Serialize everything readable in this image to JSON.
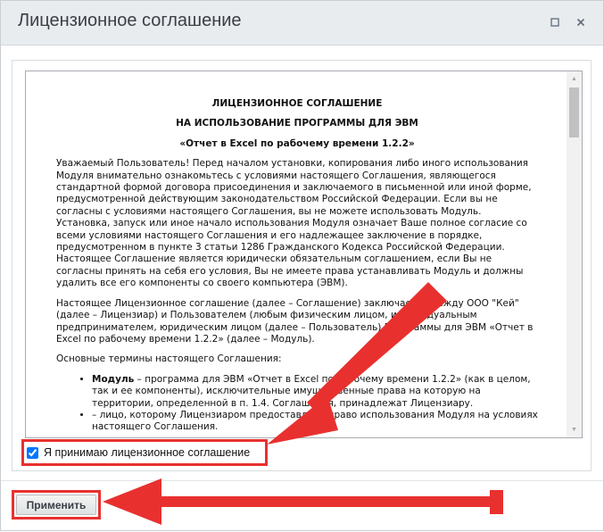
{
  "window": {
    "title": "Лицензионное соглашение",
    "maximize_icon": "maximize-icon",
    "close_icon": "close-icon"
  },
  "document": {
    "heading1": "ЛИЦЕНЗИОННОЕ СОГЛАШЕНИЕ",
    "heading2": "НА ИСПОЛЬЗОВАНИЕ ПРОГРАММЫ ДЛЯ ЭВМ",
    "heading3": "«Отчет в Excel по рабочему времени 1.2.2»",
    "paragraph1": "Уважаемый Пользователь! Перед началом установки, копирования либо иного использования Модуля внимательно ознакомьтесь с условиями настоящего Соглашения, являющегося стандартной формой договора присоединения и заключаемого в письменной или иной форме, предусмотренной действующим законодательством Российской Федерации. Если вы не согласны с условиями настоящего Соглашения, вы не можете использовать Модуль. Установка, запуск или иное начало использования Модуля означает Ваше полное согласие со всеми условиями настоящего Соглашения и его надлежащее заключение в порядке, предусмотренном в пункте 3 статьи 1286 Гражданского Кодекса Российской Федерации. Настоящее Соглашение является юридически обязательным соглашением, если Вы не согласны принять на себя его условия, Вы не имеете права устанавливать Модуль и должны удалить все его компоненты со своего компьютера (ЭВМ).",
    "paragraph2": "Настоящее Лицензионное соглашение (далее – Соглашение) заключается между ООО \"Кей\" (далее – Лицензиар) и Пользователем (любым физическим лицом, индивидуальным предпринимателем, юридическим лицом (далее – Пользователь) Программы для ЭВМ «Отчет в Excel по рабочему времени 1.2.2» (далее – Модуль).",
    "paragraph3": "Основные термины настоящего Соглашения:",
    "term1_name": "Модуль",
    "term1_text": " – программа для ЭВМ «Отчет в Excel по рабочему времени 1.2.2» (как в целом, так и ее компоненты), исключительные имущественные права на которую на территории, определенной в п. 1.4. Соглашения, принадлежат Лицензиару.",
    "term2_text": "– лицо, которому Лицензиаром предоставлено право использования Модуля на условиях настоящего Соглашения."
  },
  "accept": {
    "label": "Я принимаю лицензионное соглашение",
    "checked": true
  },
  "footer": {
    "apply_label": "Применить"
  },
  "colors": {
    "highlight": "#e8312f",
    "titlebar": "#e8ecef"
  }
}
